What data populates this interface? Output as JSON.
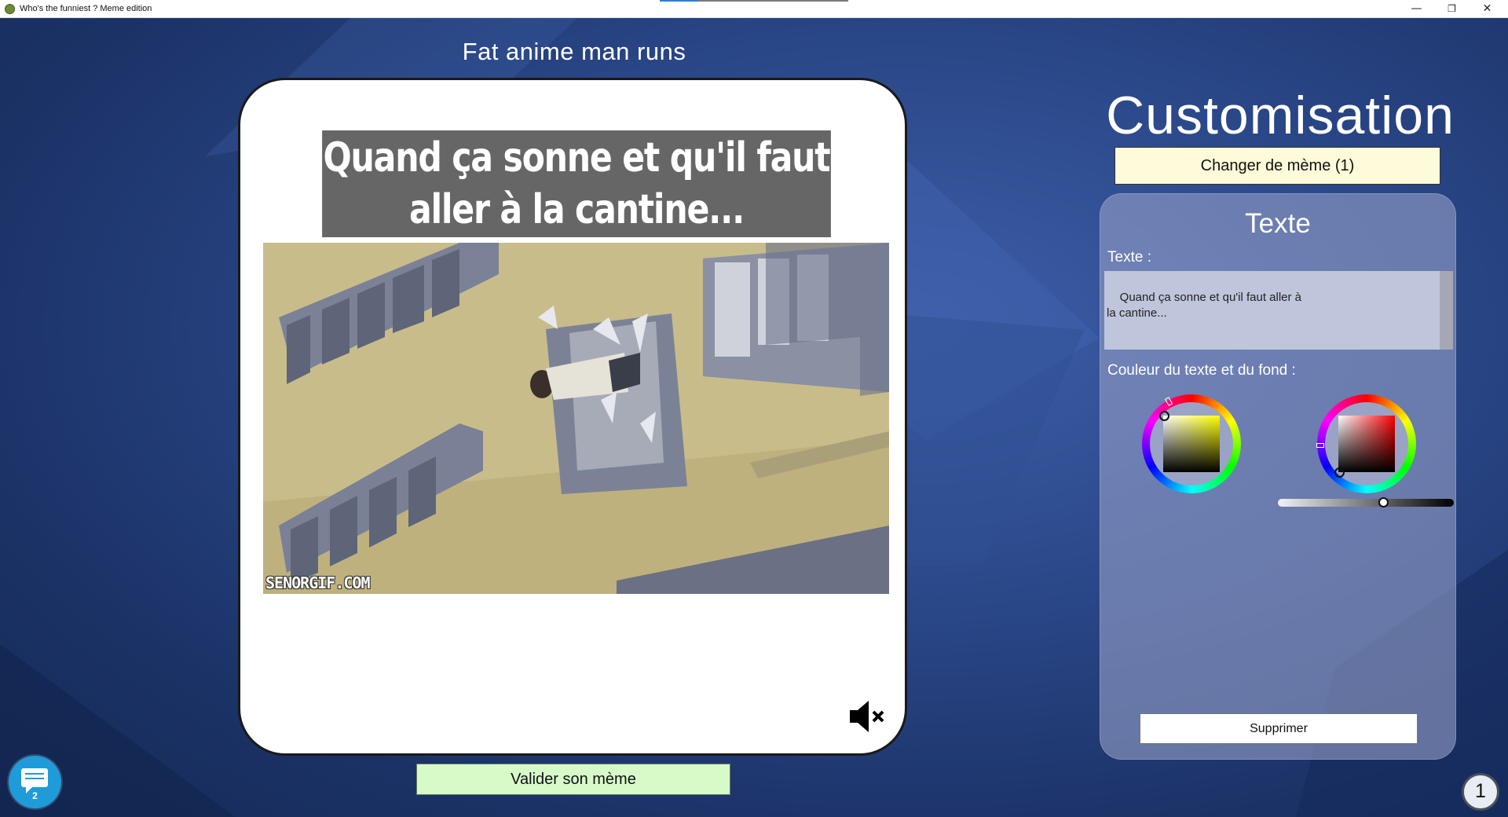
{
  "window": {
    "title": "Who's the funniest ? Meme edition",
    "minimize_glyph": "—",
    "restore_glyph": "❐",
    "close_glyph": "✕"
  },
  "meme": {
    "name": "Fat anime man runs",
    "caption": "Quand ça sonne et qu'il faut aller à la cantine...",
    "watermark": "SENORGIF.COM",
    "muted": true
  },
  "actions": {
    "validate_label": "Valider son mème"
  },
  "customisation": {
    "title": "Customisation",
    "change_meme_label": "Changer de mème (1)",
    "panel_title": "Texte",
    "text_label": "Texte :",
    "text_value": "Quand ça sonne et qu'il faut aller à\nla cantine...",
    "color_label": "Couleur du texte et du fond :",
    "text_color": {
      "hue": "#ffff00",
      "value": "#ffff00"
    },
    "background_color": {
      "hue": "#ff0000",
      "value": "#000000"
    },
    "opacity_level": 0.6,
    "delete_label": "Supprimer"
  },
  "chat": {
    "unread": "2"
  },
  "timer": {
    "value": "1"
  },
  "colors": {
    "validate_bg": "#d6fbc9",
    "change_bg": "#fdfbd9",
    "chat_bg": "#1e9bd8",
    "caption_bg": "#666666"
  },
  "icons": [
    "app-icon",
    "mute-icon",
    "chat-icon",
    "stopwatch-icon",
    "minimize-icon",
    "restore-icon",
    "close-icon"
  ]
}
